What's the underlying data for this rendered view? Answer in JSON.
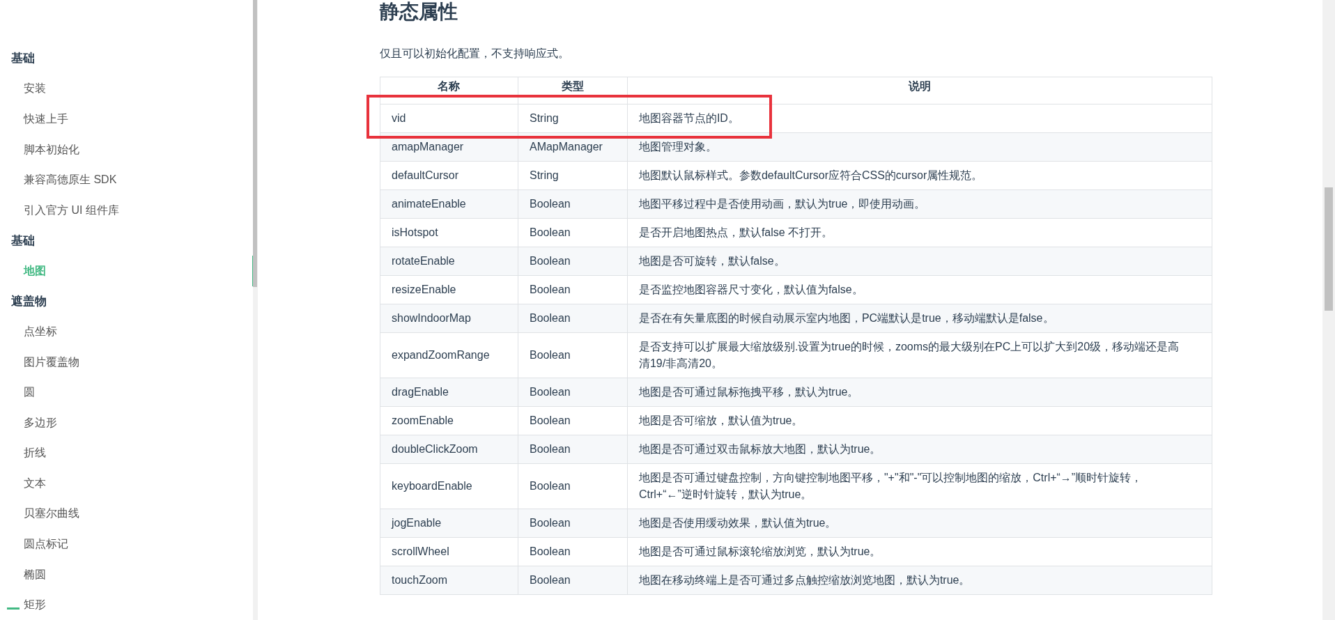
{
  "sidebar": {
    "groups": [
      {
        "title": "基础",
        "items": [
          {
            "label": "安装",
            "selected": false
          },
          {
            "label": "快速上手",
            "selected": false
          },
          {
            "label": "脚本初始化",
            "selected": false
          },
          {
            "label": "兼容高德原生 SDK",
            "selected": false
          },
          {
            "label": "引入官方 UI 组件库",
            "selected": false
          }
        ]
      },
      {
        "title": "基础",
        "items": [
          {
            "label": "地图",
            "selected": true
          }
        ]
      },
      {
        "title": "遮盖物",
        "items": [
          {
            "label": "点坐标",
            "selected": false
          },
          {
            "label": "图片覆盖物",
            "selected": false
          },
          {
            "label": "圆",
            "selected": false
          },
          {
            "label": "多边形",
            "selected": false
          },
          {
            "label": "折线",
            "selected": false
          },
          {
            "label": "文本",
            "selected": false
          },
          {
            "label": "贝塞尔曲线",
            "selected": false
          },
          {
            "label": "圆点标记",
            "selected": false
          },
          {
            "label": "椭圆",
            "selected": false
          },
          {
            "label": "矩形",
            "selected": false
          }
        ]
      }
    ]
  },
  "content": {
    "heading": "静态属性",
    "intro": "仅且可以初始化配置，不支持响应式。",
    "table": {
      "columns": [
        "名称",
        "类型",
        "说明"
      ],
      "rows": [
        {
          "name": "vid",
          "type": "String",
          "description": "地图容器节点的ID。",
          "highlighted": true
        },
        {
          "name": "amapManager",
          "type": "AMapManager",
          "description": "地图管理对象。",
          "highlighted": false
        },
        {
          "name": "defaultCursor",
          "type": "String",
          "description": "地图默认鼠标样式。参数defaultCursor应符合CSS的cursor属性规范。",
          "highlighted": false
        },
        {
          "name": "animateEnable",
          "type": "Boolean",
          "description": "地图平移过程中是否使用动画，默认为true，即使用动画。",
          "highlighted": false
        },
        {
          "name": "isHotspot",
          "type": "Boolean",
          "description": "是否开启地图热点，默认false 不打开。",
          "highlighted": false
        },
        {
          "name": "rotateEnable",
          "type": "Boolean",
          "description": "地图是否可旋转，默认false。",
          "highlighted": false
        },
        {
          "name": "resizeEnable",
          "type": "Boolean",
          "description": "是否监控地图容器尺寸变化，默认值为false。",
          "highlighted": false
        },
        {
          "name": "showIndoorMap",
          "type": "Boolean",
          "description": "是否在有矢量底图的时候自动展示室内地图，PC端默认是true，移动端默认是false。",
          "highlighted": false
        },
        {
          "name": "expandZoomRange",
          "type": "Boolean",
          "description": "是否支持可以扩展最大缩放级别.设置为true的时候，zooms的最大级别在PC上可以扩大到20级，移动端还是高清19/非高清20。",
          "highlighted": false
        },
        {
          "name": "dragEnable",
          "type": "Boolean",
          "description": "地图是否可通过鼠标拖拽平移，默认为true。",
          "highlighted": false
        },
        {
          "name": "zoomEnable",
          "type": "Boolean",
          "description": "地图是否可缩放，默认值为true。",
          "highlighted": false
        },
        {
          "name": "doubleClickZoom",
          "type": "Boolean",
          "description": "地图是否可通过双击鼠标放大地图，默认为true。",
          "highlighted": false
        },
        {
          "name": "keyboardEnable",
          "type": "Boolean",
          "description": "地图是否可通过键盘控制，方向键控制地图平移，\"+\"和\"-\"可以控制地图的缩放，Ctrl+“→”顺时针旋转，Ctrl+“←”逆时针旋转，默认为true。",
          "highlighted": false
        },
        {
          "name": "jogEnable",
          "type": "Boolean",
          "description": "地图是否使用缓动效果，默认值为true。",
          "highlighted": false
        },
        {
          "name": "scrollWheel",
          "type": "Boolean",
          "description": "地图是否可通过鼠标滚轮缩放浏览，默认为true。",
          "highlighted": false
        },
        {
          "name": "touchZoom",
          "type": "Boolean",
          "description": "地图在移动终端上是否可通过多点触控缩放浏览地图，默认为true。",
          "highlighted": false
        }
      ]
    }
  }
}
